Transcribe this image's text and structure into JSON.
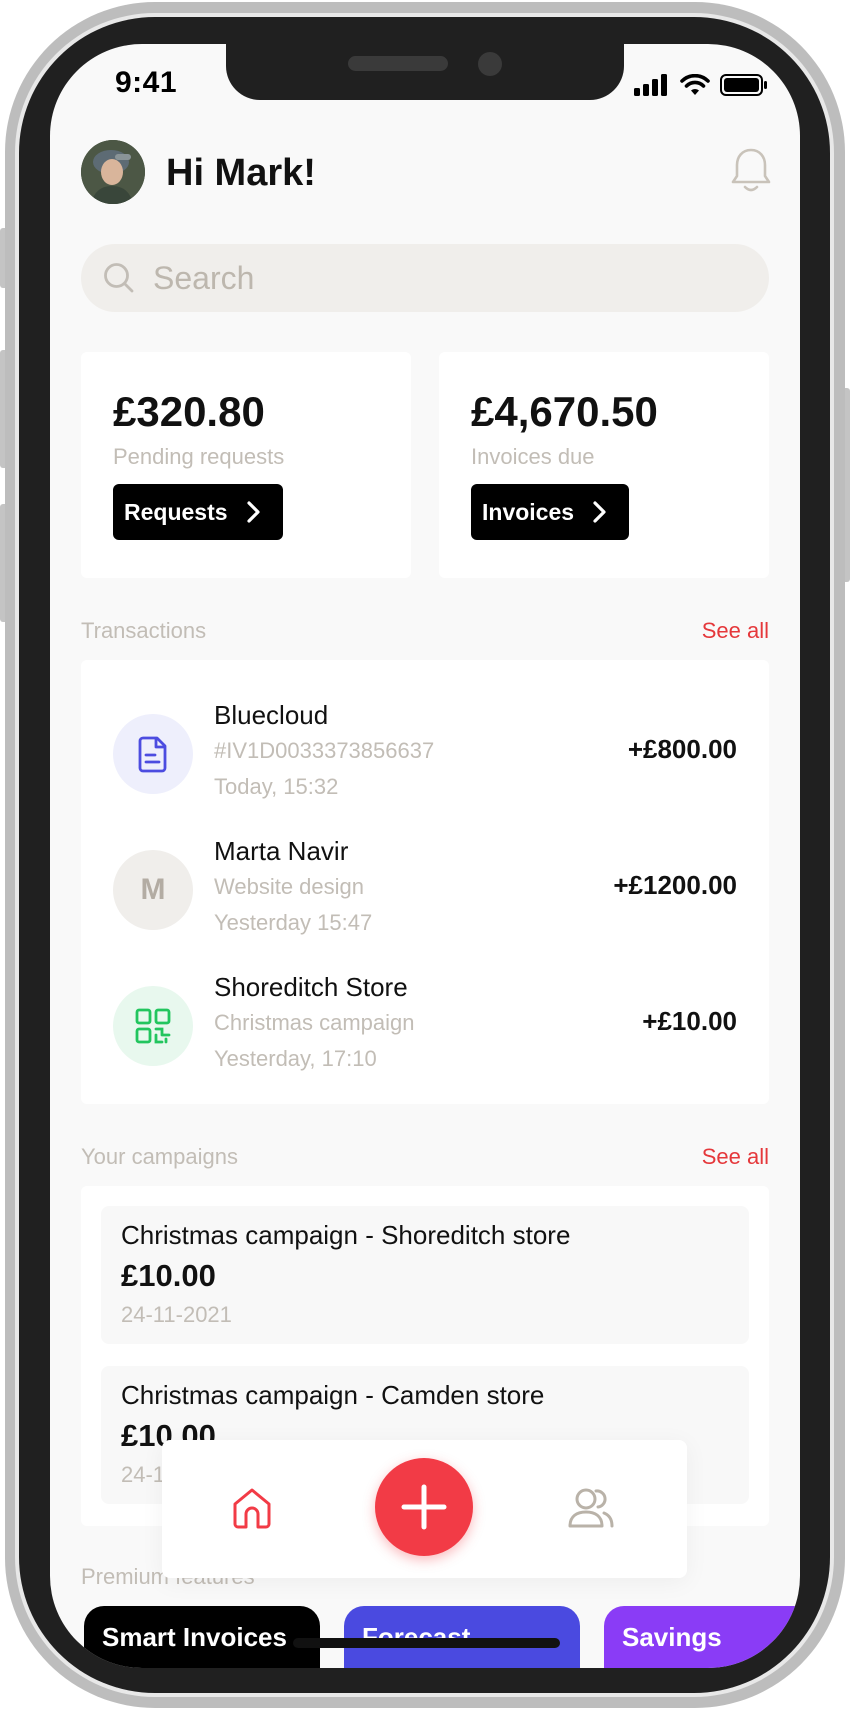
{
  "status_bar": {
    "time": "9:41"
  },
  "header": {
    "greeting": "Hi Mark!"
  },
  "search": {
    "placeholder": "Search"
  },
  "summary_cards": [
    {
      "amount": "£320.80",
      "label": "Pending requests",
      "button": "Requests"
    },
    {
      "amount": "£4,670.50",
      "label": "Invoices due",
      "button": "Invoices"
    }
  ],
  "transactions": {
    "title": "Transactions",
    "see_all": "See all",
    "items": [
      {
        "name": "Bluecloud",
        "detail": "#IV1D0033373856637",
        "date": "Today, 15:32",
        "amount": "+£800.00",
        "icon": "document-icon"
      },
      {
        "name": "Marta Navir",
        "detail": "Website design",
        "date": "Yesterday 15:47",
        "amount": "+£1200.00",
        "initial": "M"
      },
      {
        "name": "Shoreditch Store",
        "detail": "Christmas campaign",
        "date": "Yesterday, 17:10",
        "amount": "+£10.00",
        "icon": "qr-code-icon"
      }
    ]
  },
  "campaigns": {
    "title": "Your campaigns",
    "see_all": "See all",
    "items": [
      {
        "title": "Christmas campaign - Shoreditch store",
        "amount": "£10.00",
        "date": "24-11-2021"
      },
      {
        "title": "Christmas campaign - Camden store",
        "amount": "£10.00",
        "date": "24-11-2021"
      }
    ]
  },
  "premium": {
    "title": "Premium features",
    "items": [
      {
        "label": "Smart Invoices",
        "color": "#000000"
      },
      {
        "label": "Forecast",
        "color": "#4a4ae0"
      },
      {
        "label": "Savings",
        "color": "#8a3cf6"
      }
    ]
  },
  "bottom_nav": {
    "items": [
      "home-icon",
      "add-icon",
      "users-icon"
    ],
    "accent": "#f23b46"
  }
}
